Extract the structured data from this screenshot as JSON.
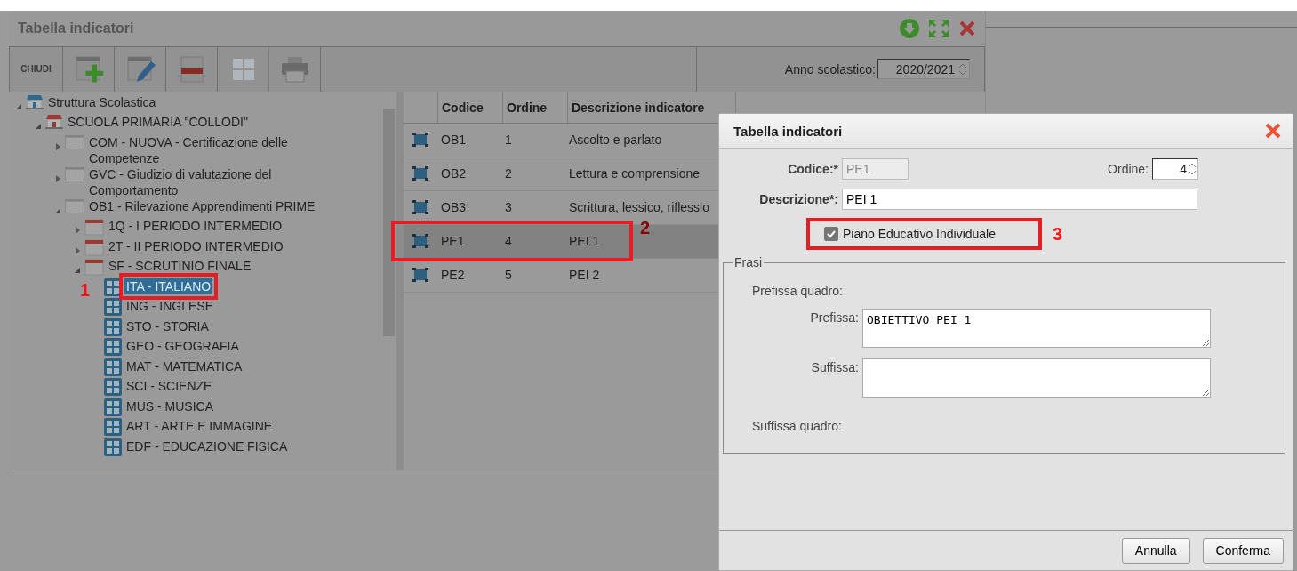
{
  "window": {
    "title": "Tabella indicatori"
  },
  "toolbar": {
    "buttons": [
      {
        "kind": "text",
        "label": "CHIUDI",
        "disabled": false
      },
      {
        "kind": "add",
        "disabled": false
      },
      {
        "kind": "edit",
        "disabled": false
      },
      {
        "kind": "delete",
        "disabled": false
      },
      {
        "kind": "grid",
        "disabled": true
      },
      {
        "kind": "print",
        "disabled": false
      }
    ],
    "year_label": "Anno scolastico:",
    "year_value": "2020/2021"
  },
  "tree": [
    {
      "kind": "structure",
      "label": "Struttura Scolastica",
      "expanded": true,
      "children": [
        {
          "kind": "school",
          "label": "SCUOLA PRIMARIA \"COLLODI\"",
          "expanded": true,
          "children": [
            {
              "kind": "scheme",
              "label": "COM - NUOVA - Certificazione delle Competenze",
              "expanded": false
            },
            {
              "kind": "scheme",
              "label": "GVC - Giudizio di valutazione del Comportamento",
              "expanded": false
            },
            {
              "kind": "scheme",
              "label": "OB1 - Rilevazione Apprendimenti PRIME",
              "expanded": true,
              "children": [
                {
                  "kind": "period",
                  "label": "1Q - I PERIODO INTERMEDIO",
                  "expanded": false
                },
                {
                  "kind": "period",
                  "label": "2T - II PERIODO INTERMEDIO",
                  "expanded": false
                },
                {
                  "kind": "period",
                  "label": "SF - SCRUTINIO FINALE",
                  "expanded": true,
                  "children": [
                    {
                      "kind": "subject",
                      "label": "ITA - ITALIANO",
                      "selected": true,
                      "callout": "1"
                    },
                    {
                      "kind": "subject",
                      "label": "ING - INGLESE",
                      "selected": false
                    },
                    {
                      "kind": "subject",
                      "label": "STO - STORIA",
                      "selected": false
                    },
                    {
                      "kind": "subject",
                      "label": "GEO - GEOGRAFIA",
                      "selected": false
                    },
                    {
                      "kind": "subject",
                      "label": "MAT - MATEMATICA",
                      "selected": false
                    },
                    {
                      "kind": "subject",
                      "label": "SCI - SCIENZE",
                      "selected": false
                    },
                    {
                      "kind": "subject",
                      "label": "MUS - MUSICA",
                      "selected": false
                    },
                    {
                      "kind": "subject",
                      "label": "ART - ARTE E IMMAGINE",
                      "selected": false
                    },
                    {
                      "kind": "subject",
                      "label": "EDF - EDUCAZIONE FISICA",
                      "selected": false
                    }
                  ]
                }
              ]
            }
          ]
        }
      ]
    }
  ],
  "table": {
    "columns": [
      "Codice",
      "Ordine",
      "Descrizione indicatore"
    ],
    "rows": [
      {
        "cells": [
          "OB1",
          "1",
          "Ascolto e parlato"
        ],
        "selected": false
      },
      {
        "cells": [
          "OB2",
          "2",
          "Lettura e comprensione"
        ],
        "selected": false
      },
      {
        "cells": [
          "OB3",
          "3",
          "Scrittura, lessico, riflessio"
        ],
        "selected": false
      },
      {
        "cells": [
          "PE1",
          "4",
          "PEI 1"
        ],
        "selected": true,
        "callout": "2"
      },
      {
        "cells": [
          "PE2",
          "5",
          "PEI 2"
        ],
        "selected": false
      }
    ]
  },
  "dialog": {
    "title": "Tabella indicatori",
    "code_label": "Codice:*",
    "code_value": "PE1",
    "order_label": "Ordine:",
    "order_value": "4",
    "desc_label": "Descrizione*:",
    "desc_value": "PEI 1",
    "pei": {
      "label": "Piano Educativo Individuale",
      "checked": true,
      "callout": "3"
    },
    "fieldset": {
      "legend": "Frasi",
      "prefix_frame_label": "Prefissa quadro:",
      "prefix_label": "Prefissa:",
      "prefix_value": "OBIETTIVO PEI 1",
      "suffix_label": "Suffissa:",
      "suffix_frame_label": "Suffissa quadro:"
    },
    "buttons": [
      "Annulla",
      "Conferma"
    ]
  }
}
